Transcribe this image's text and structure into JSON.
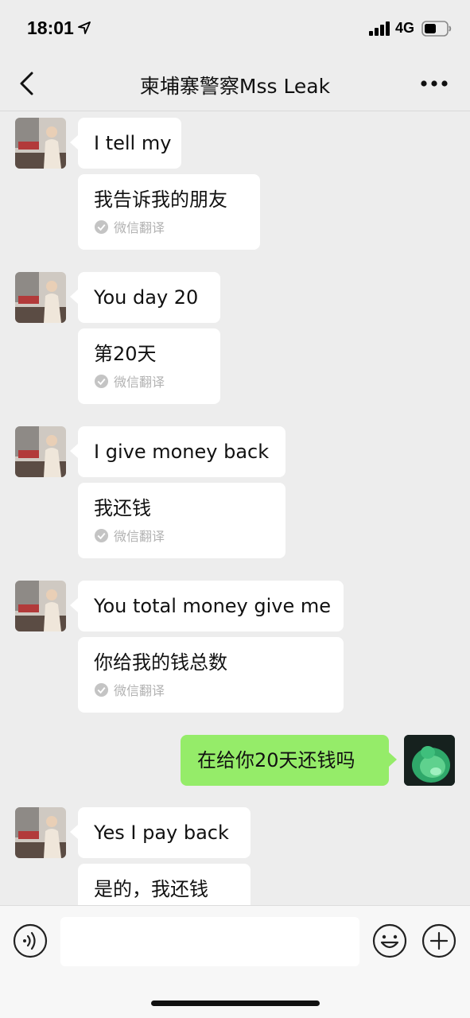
{
  "status_bar": {
    "time": "18:01",
    "network": "4G"
  },
  "nav": {
    "title": "柬埔寨警察Mss Leak"
  },
  "translation_label": "微信翻译",
  "messages": [
    {
      "original": "I tell my",
      "translation": "我告诉我的朋友"
    },
    {
      "original": "You day 20",
      "translation": "第20天"
    },
    {
      "original": "I give money back",
      "translation": "我还钱"
    },
    {
      "original": "You total money give me",
      "translation": "你给我的钱总数"
    },
    {
      "outgoing": "在给你20天还钱吗"
    },
    {
      "original": "Yes I pay back",
      "translation": "是的，我还钱"
    }
  ],
  "input": {
    "placeholder": ""
  },
  "colors": {
    "outgoing_bubble": "#95ec69",
    "background": "#ededed",
    "incoming_bubble": "#ffffff"
  }
}
